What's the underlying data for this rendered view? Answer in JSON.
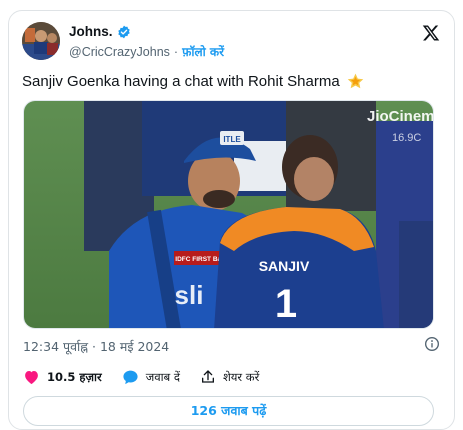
{
  "author": {
    "display_name": "Johns.",
    "handle": "@CricCrazyJohns",
    "separator": "·",
    "follow_label": "फ़ॉलो करें",
    "verified": true,
    "avatar_icon": "profile-avatar"
  },
  "tweet": {
    "text": "Sanjiv Goenka having a chat with Rohit Sharma",
    "emoji_icon": "glowing-star-icon",
    "media": {
      "watermark": "JioCinema",
      "watermark_overlay": "16.9C",
      "jersey_left_sponsor": "IDFC FIRST Bank",
      "jersey_left_text": "sli",
      "jersey_right_name": "SANJIV",
      "jersey_right_number": "1",
      "cap_logo": "ITLE"
    },
    "timestamp": "12:34 पूर्वाह्न · 18 मई 2024"
  },
  "actions": {
    "like_count": "10.5 हज़ार",
    "reply_label": "जवाब दें",
    "share_label": "शेयर करें"
  },
  "replies_button_label": "126 जवाब पढ़ें",
  "colors": {
    "accent": "#1d9bf0",
    "like": "#f91880",
    "text": "#0f1419",
    "secondary": "#536471"
  }
}
